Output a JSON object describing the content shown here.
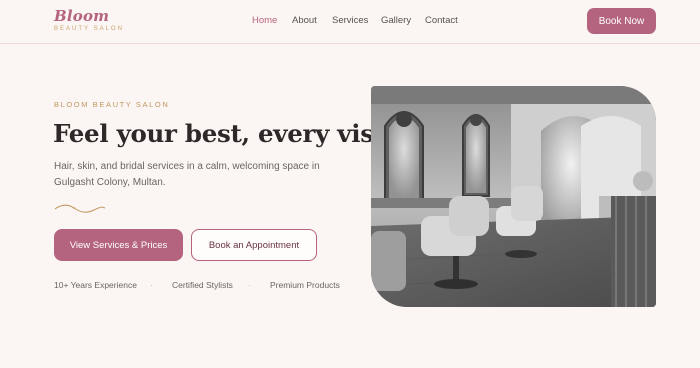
{
  "brand": {
    "name": "Bloom",
    "tagline": "BEAUTY SALON"
  },
  "nav": {
    "items": [
      {
        "label": "Home",
        "active": true
      },
      {
        "label": "About",
        "active": false
      },
      {
        "label": "Services",
        "active": false
      },
      {
        "label": "Gallery",
        "active": false
      },
      {
        "label": "Contact",
        "active": false
      }
    ],
    "cta_label": "Book Now"
  },
  "hero": {
    "eyebrow": "BLOOM BEAUTY SALON",
    "headline": "Feel your best, every visit.",
    "subtitle": "Hair, skin, and bridal services in a calm, welcoming space in Gulgasht Colony, Multan.",
    "primary_cta": "View Services & Prices",
    "secondary_cta": "Book an Appointment",
    "features": [
      "10+ Years Experience",
      "Certified Stylists",
      "Premium Products"
    ],
    "image_icon": "salon-interior-photo"
  },
  "colors": {
    "accent": "#b5647f",
    "gold": "#c09760",
    "background": "#fbf6f3",
    "heading": "#2f2829",
    "body_text": "#6d6365"
  }
}
